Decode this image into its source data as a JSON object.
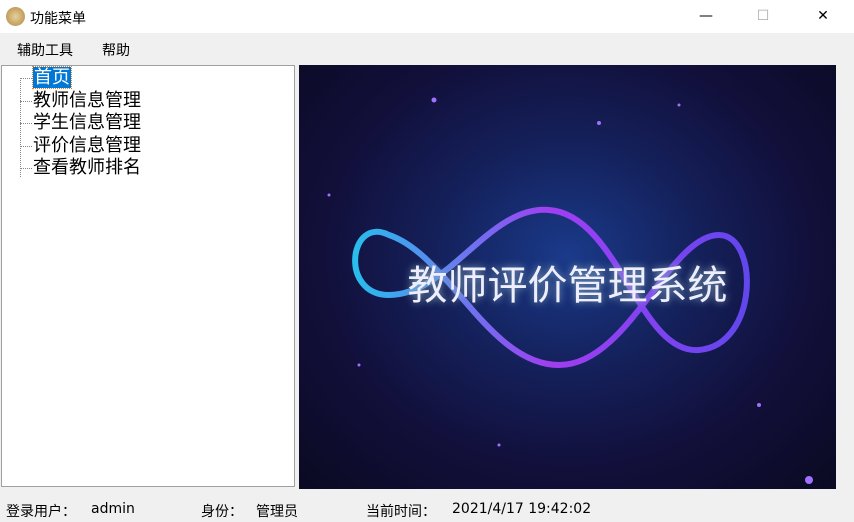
{
  "window": {
    "title": "功能菜单",
    "minimize": "—",
    "maximize": "☐",
    "close": "✕"
  },
  "menu": [
    "辅助工具",
    "帮助"
  ],
  "tree": {
    "items": [
      "首页",
      "教师信息管理",
      "学生信息管理",
      "评价信息管理",
      "查看教师排名"
    ],
    "selected": 0
  },
  "banner": {
    "title": "教师评价管理系统"
  },
  "status": {
    "user_label": "登录用户：",
    "user": "admin",
    "role_label": "身份：",
    "role": "管理员",
    "time_label": "当前时间：",
    "time": "2021/4/17 19:42:02"
  }
}
